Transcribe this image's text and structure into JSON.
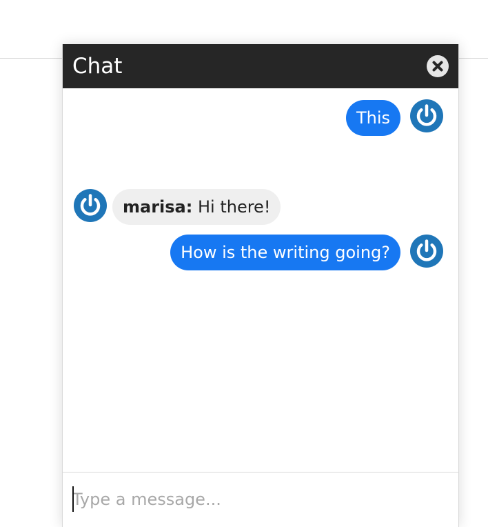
{
  "chat": {
    "title": "Chat",
    "close_icon": "close-circle-icon",
    "avatar_icon": "power-icon",
    "colors": {
      "header_background": "#262626",
      "outgoing_bubble": "#1778f2",
      "incoming_bubble": "#efefef",
      "avatar": "#1f76b8"
    },
    "messages": [
      {
        "direction": "outgoing",
        "text": "This"
      },
      {
        "direction": "incoming",
        "sender": "marisa:",
        "text": "Hi there!"
      },
      {
        "direction": "outgoing",
        "text": "How is the writing going?"
      }
    ],
    "composer": {
      "placeholder": "Type a message...",
      "value": ""
    }
  }
}
